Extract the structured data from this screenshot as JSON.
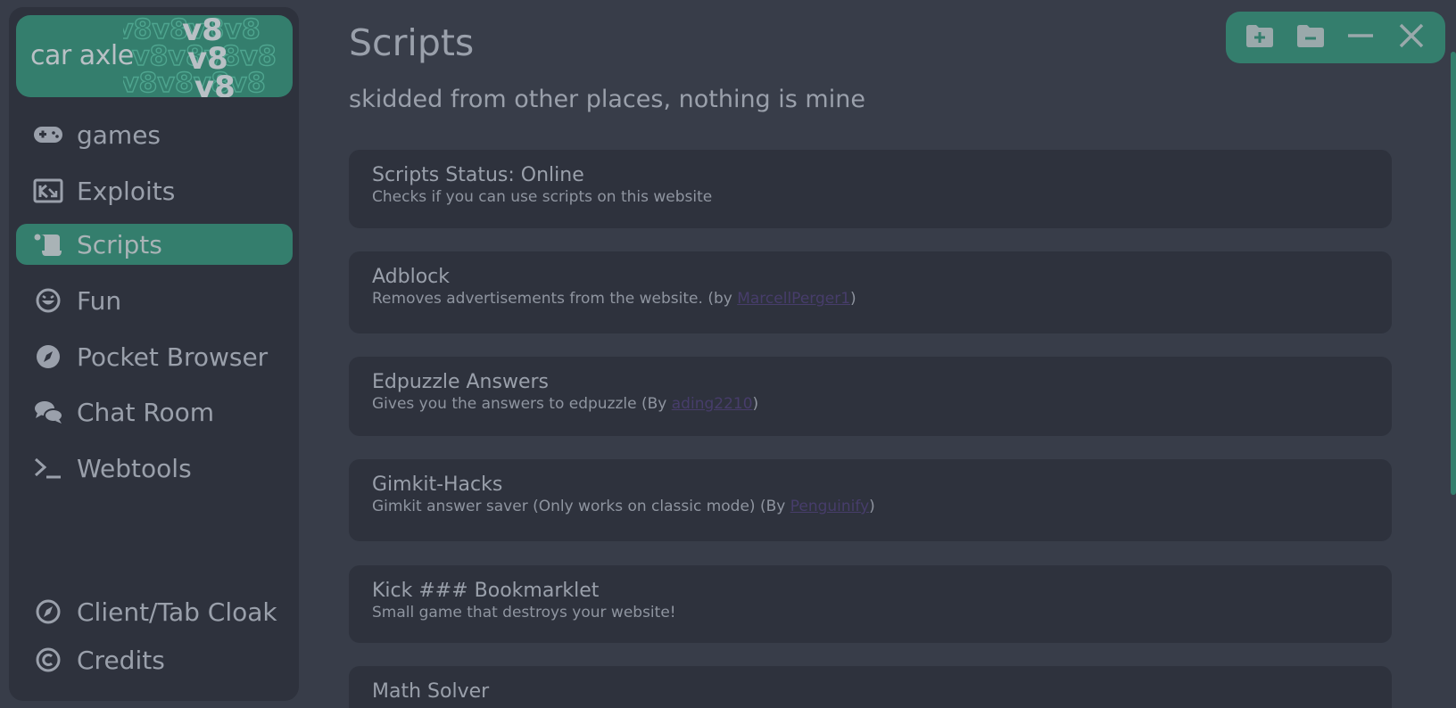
{
  "brand": {
    "name": "car axle",
    "pattern_text": "v8",
    "accent_color": "#347e6d"
  },
  "sidebar": {
    "items": [
      {
        "label": "games",
        "icon": "gamepad-icon"
      },
      {
        "label": "Exploits",
        "icon": "exploit-window-icon"
      },
      {
        "label": "Scripts",
        "icon": "scroll-icon",
        "active": true
      },
      {
        "label": "Fun",
        "icon": "laugh-face-icon"
      },
      {
        "label": "Pocket Browser",
        "icon": "compass-icon"
      },
      {
        "label": "Chat Room",
        "icon": "chat-bubbles-icon"
      },
      {
        "label": "Webtools",
        "icon": "terminal-icon"
      }
    ],
    "bottom_items": [
      {
        "label": "Client/Tab Cloak",
        "icon": "compass-outline-icon"
      },
      {
        "label": "Credits",
        "icon": "copyright-icon"
      }
    ]
  },
  "main": {
    "title": "Scripts",
    "subtitle": "skidded from other places, nothing is mine",
    "cards": [
      {
        "title": "Scripts Status: Online",
        "desc": "Checks if you can use scripts on this website"
      },
      {
        "title": "Adblock",
        "desc_pre": "Removes advertisements from the website. (by ",
        "link": "MarcellPerger1",
        "desc_post": ")"
      },
      {
        "title": "Edpuzzle Answers",
        "desc_pre": "Gives you the answers to edpuzzle (By ",
        "link": "ading2210",
        "desc_post": ")"
      },
      {
        "title": "Gimkit-Hacks",
        "desc_pre": "Gimkit answer saver (Only works on classic mode) (By ",
        "link": "Penguinify",
        "desc_post": ")"
      },
      {
        "title": "Kick ### Bookmarklet",
        "desc": "Small game that destroys your website!"
      },
      {
        "title": "Math Solver",
        "desc": ""
      }
    ]
  },
  "window_controls": [
    {
      "icon": "folder-plus-icon"
    },
    {
      "icon": "folder-minus-icon"
    },
    {
      "icon": "minimize-icon"
    },
    {
      "icon": "close-icon"
    }
  ]
}
